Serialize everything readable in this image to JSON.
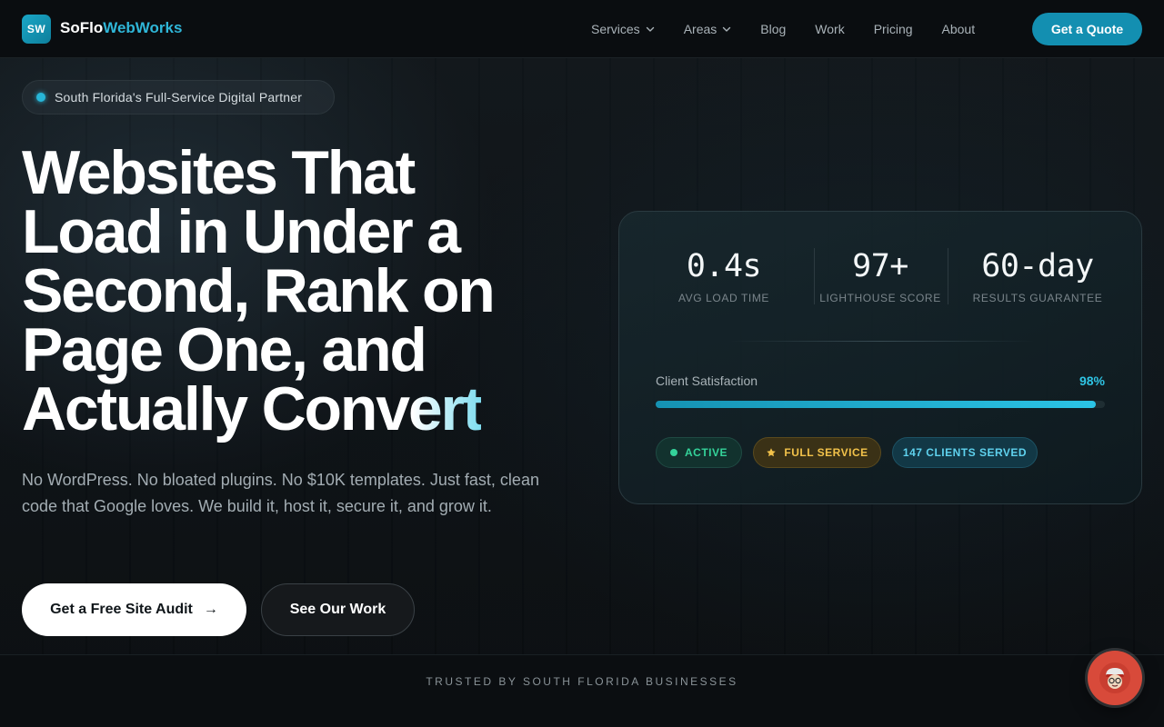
{
  "brand": {
    "badge": "SW",
    "name_part1": "SoFlo",
    "name_part2": "WebWorks"
  },
  "nav": {
    "items": [
      {
        "label": "Services",
        "dropdown": true
      },
      {
        "label": "Areas",
        "dropdown": true
      },
      {
        "label": "Blog",
        "dropdown": false
      },
      {
        "label": "Work",
        "dropdown": false
      },
      {
        "label": "Pricing",
        "dropdown": false
      },
      {
        "label": "About",
        "dropdown": false
      }
    ],
    "cta": "Get a Quote"
  },
  "hero": {
    "pill": "South Florida's Full-Service Digital Partner",
    "headline_lines": [
      "Websites That",
      "Load in Under a",
      "Second, Rank on",
      "Page One, and"
    ],
    "headline_last_plain": "Actually Con",
    "headline_last_grad": "vert",
    "subcopy": "No WordPress. No bloated plugins. No $10K templates. Just fast, clean code that Google loves. We build it, host it, secure it, and grow it.",
    "primary_button": "Get a Free Site Audit",
    "primary_arrow": "→",
    "secondary_button": "See Our Work"
  },
  "stats_card": {
    "stats": [
      {
        "value": "0.4s",
        "label": "AVG LOAD TIME"
      },
      {
        "value": "97+",
        "label": "LIGHTHOUSE SCORE"
      },
      {
        "value": "60-day",
        "label": "RESULTS GUARANTEE"
      }
    ],
    "satisfaction_label": "Client Satisfaction",
    "satisfaction_value": "98%",
    "satisfaction_fraction": 0.98,
    "tags": {
      "active": "ACTIVE",
      "full_service": "FULL SERVICE",
      "clients": "147 CLIENTS SERVED"
    }
  },
  "trusted": {
    "text": "TRUSTED BY SOUTH FLORIDA BUSINESSES"
  },
  "colors": {
    "accent": "#138fb1",
    "accent_light": "#2fc4e4",
    "active_green": "#34d39a",
    "gold": "#f2c24a",
    "chat_red": "#d84a3a"
  },
  "icons": {
    "nav_dropdown": "chevron-down-icon",
    "primary_arrow": "arrow-right-icon",
    "full_service_tag": "star-icon",
    "chat": "chat-avatar-icon"
  }
}
